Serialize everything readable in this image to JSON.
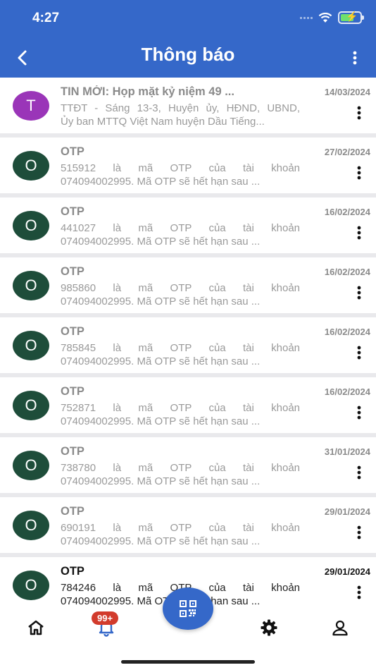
{
  "status_bar": {
    "time": "4:27"
  },
  "header": {
    "title": "Thông báo",
    "back_icon": "back-arrow-icon",
    "menu_icon": "more-vertical-icon"
  },
  "notifications": [
    {
      "avatar_letter": "T",
      "avatar_color": "#9a35b8",
      "title": "TIN MỚI: Họp mặt kỷ niệm 49 ...",
      "date": "14/03/2024",
      "body_line1": "TTĐT - Sáng 13-3, Huyện ủy, HĐND, UBND,",
      "body_line2": "Ủy ban MTTQ Việt Nam huyện Dầu Tiếng...",
      "unread": false
    },
    {
      "avatar_letter": "O",
      "avatar_color": "#1e4d3a",
      "title": "OTP",
      "date": "27/02/2024",
      "body_line1": "515912 là mã OTP của tài khoản",
      "body_line2": "074094002995. Mã OTP sẽ hết hạn sau ...",
      "unread": false
    },
    {
      "avatar_letter": "O",
      "avatar_color": "#1e4d3a",
      "title": "OTP",
      "date": "16/02/2024",
      "body_line1": "441027 là mã OTP của tài khoản",
      "body_line2": "074094002995. Mã OTP sẽ hết hạn sau ...",
      "unread": false
    },
    {
      "avatar_letter": "O",
      "avatar_color": "#1e4d3a",
      "title": "OTP",
      "date": "16/02/2024",
      "body_line1": "985860 là mã OTP của tài khoản",
      "body_line2": "074094002995. Mã OTP sẽ hết hạn sau ...",
      "unread": false
    },
    {
      "avatar_letter": "O",
      "avatar_color": "#1e4d3a",
      "title": "OTP",
      "date": "16/02/2024",
      "body_line1": "785845 là mã OTP của tài khoản",
      "body_line2": "074094002995. Mã OTP sẽ hết hạn sau ...",
      "unread": false
    },
    {
      "avatar_letter": "O",
      "avatar_color": "#1e4d3a",
      "title": "OTP",
      "date": "16/02/2024",
      "body_line1": "752871 là mã OTP của tài khoản",
      "body_line2": "074094002995. Mã OTP sẽ hết hạn sau ...",
      "unread": false
    },
    {
      "avatar_letter": "O",
      "avatar_color": "#1e4d3a",
      "title": "OTP",
      "date": "31/01/2024",
      "body_line1": "738780 là mã OTP của tài khoản",
      "body_line2": "074094002995. Mã OTP sẽ hết hạn sau ...",
      "unread": false
    },
    {
      "avatar_letter": "O",
      "avatar_color": "#1e4d3a",
      "title": "OTP",
      "date": "29/01/2024",
      "body_line1": "690191 là mã OTP của tài khoản",
      "body_line2": "074094002995. Mã OTP sẽ hết hạn sau ...",
      "unread": false
    },
    {
      "avatar_letter": "O",
      "avatar_color": "#1e4d3a",
      "title": "OTP",
      "date": "29/01/2024",
      "body_line1": "784246 là mã OTP của tài khoản",
      "body_line2": "074094002995. Mã OTP sẽ hết hạn sau ...",
      "unread": true
    }
  ],
  "bottom_nav": {
    "home_icon": "home-icon",
    "notifications_icon": "bell-icon",
    "notification_badge": "99+",
    "qr_icon": "qr-code-icon",
    "settings_icon": "gear-icon",
    "profile_icon": "person-icon"
  },
  "colors": {
    "primary": "#3568c9",
    "badge": "#d23b2c"
  }
}
